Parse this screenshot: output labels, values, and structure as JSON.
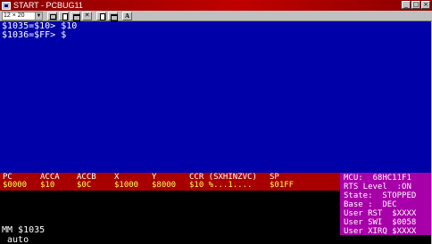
{
  "window": {
    "title": "START - PCBUG11",
    "controls": [
      "_",
      "□",
      "×"
    ]
  },
  "toolbar": {
    "font_size_select": "12 × 20",
    "buttons": [
      "grid-icon",
      "doc-icon",
      "window-icon",
      "x-icon",
      "copy-icon",
      "window-icon",
      "font-icon"
    ],
    "font_button_label": "A"
  },
  "command_window": {
    "lines": [
      "$1035=$10> $10",
      "$1036=$FF> $"
    ],
    "background": "#0000a8"
  },
  "registers": {
    "background": "#a80000",
    "items": [
      {
        "label": "PC",
        "value": "$0000"
      },
      {
        "label": "ACCA",
        "value": "$10"
      },
      {
        "label": "ACCB",
        "value": "$0C"
      },
      {
        "label": "X",
        "value": "$1000"
      },
      {
        "label": "Y",
        "value": "$8000"
      },
      {
        "label": "CCR (SXHINZVC)",
        "value": "$10 %...1...."
      },
      {
        "label": "SP",
        "value": "$01FF"
      }
    ]
  },
  "status_panel": {
    "background": "#a800a8",
    "lines": [
      "MCU:  68HC11F1",
      "RTS Level  :ON",
      "State:  STOPPED",
      "Base :  DEC",
      "User RST  $XXXX",
      "User SWI  $0058",
      "User XIRQ $XXXX"
    ]
  },
  "console": {
    "command": "MM $1035",
    "input": "_auto"
  }
}
